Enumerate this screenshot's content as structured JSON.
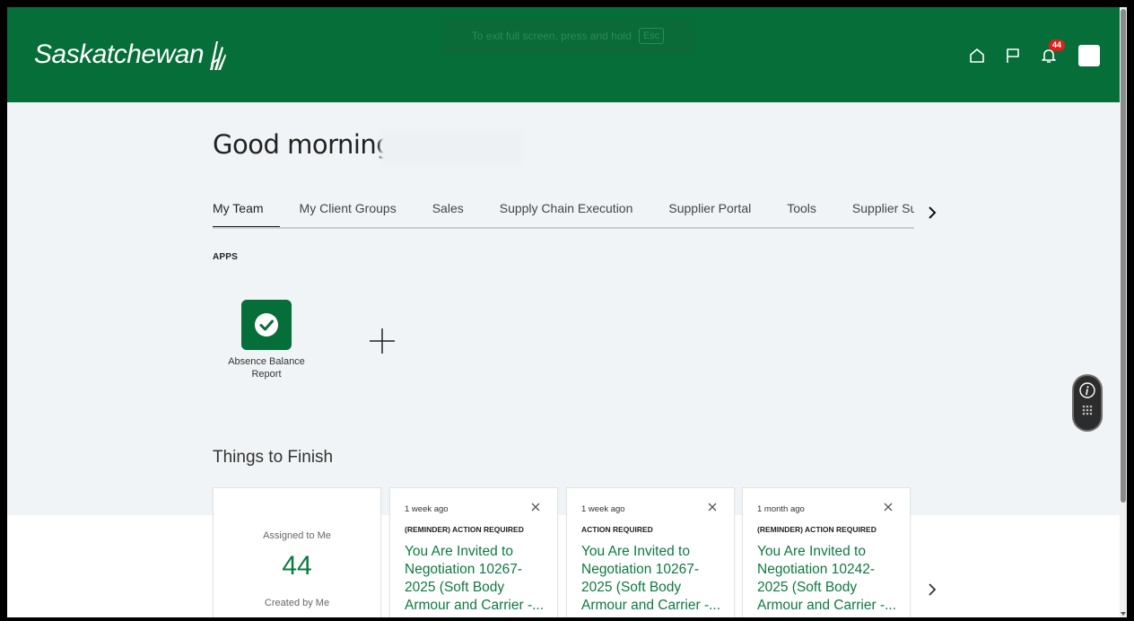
{
  "header": {
    "brand": "Saskatchewan",
    "fullscreen_toast": {
      "text": "To exit full screen, press and hold",
      "key": "Esc"
    },
    "icons": [
      "home-icon",
      "flag-icon",
      "bell-icon"
    ],
    "notification_count": "44"
  },
  "greeting": {
    "text": "Good morning,"
  },
  "tabs": [
    {
      "label": "My Team",
      "active": true
    },
    {
      "label": "My Client Groups"
    },
    {
      "label": "Sales"
    },
    {
      "label": "Supply Chain Execution"
    },
    {
      "label": "Supplier Portal"
    },
    {
      "label": "Tools"
    },
    {
      "label": "Supplier Supp"
    }
  ],
  "apps": {
    "label": "APPS",
    "items": [
      {
        "label": "Absence Balance Report",
        "icon": "check-circle-icon"
      }
    ]
  },
  "things_to_finish": {
    "title": "Things to Finish",
    "summary": {
      "assigned_label": "Assigned to Me",
      "assigned_count": "44",
      "created_label": "Created by Me"
    },
    "cards": [
      {
        "when": "1 week ago",
        "kind": "(REMINDER) ACTION REQUIRED",
        "subject": "You Are Invited to Negotiation 10267-2025 (Soft Body Armour and Carrier -..."
      },
      {
        "when": "1 week ago",
        "kind": "ACTION REQUIRED",
        "subject": "You Are Invited to Negotiation 10267-2025 (Soft Body Armour and Carrier -..."
      },
      {
        "when": "1 month ago",
        "kind": "(REMINDER) ACTION REQUIRED",
        "subject": "You Are Invited to Negotiation 10242-2025 (Soft Body Armour and Carrier -..."
      }
    ]
  },
  "colors": {
    "brand_green": "#066e38",
    "link_green": "#0d7a41",
    "badge_red": "#e0201b"
  }
}
